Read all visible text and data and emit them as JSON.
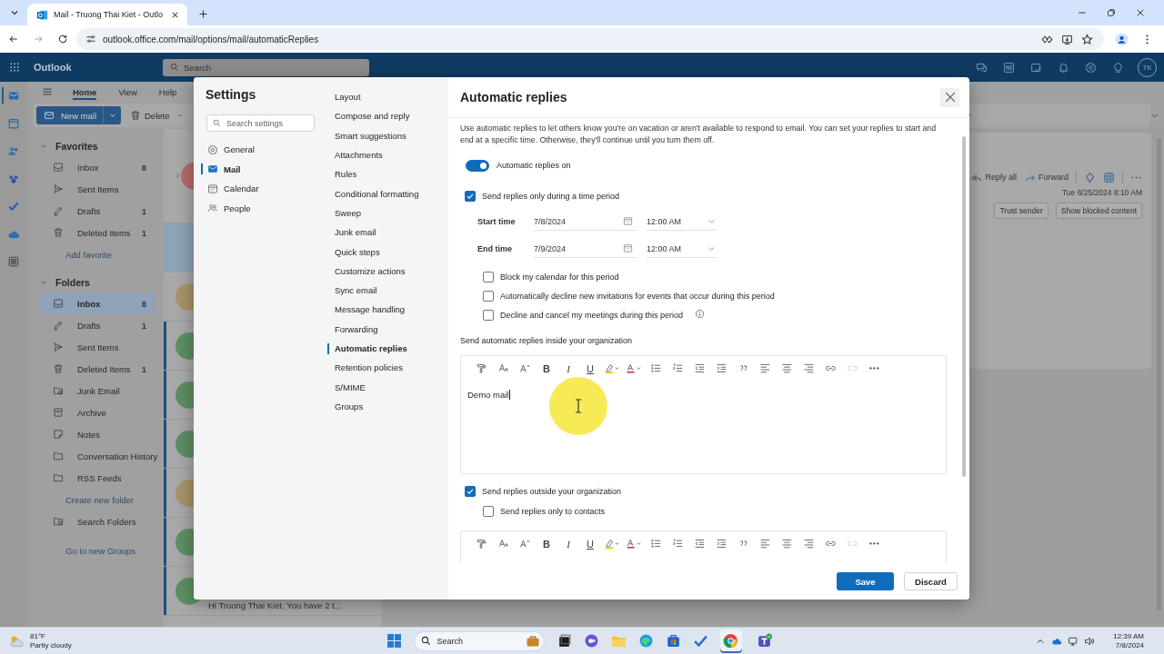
{
  "browser": {
    "tab_title": "Mail - Truong Thai Kiet - Outlo",
    "url": "outlook.office.com/mail/options/mail/automaticReplies"
  },
  "app": {
    "name": "Outlook",
    "search_placeholder": "Search",
    "avatar": "TK"
  },
  "rail": [
    {
      "kind": "mail",
      "selected": true
    },
    {
      "kind": "calendar",
      "selected": false
    },
    {
      "kind": "people",
      "selected": false
    },
    {
      "kind": "groups",
      "selected": false
    },
    {
      "kind": "todo",
      "selected": false
    },
    {
      "kind": "cloud",
      "selected": false
    },
    {
      "kind": "apps",
      "selected": false
    }
  ],
  "ribbon": {
    "tabs": [
      {
        "label": "Home",
        "selected": true
      },
      {
        "label": "View",
        "selected": false
      },
      {
        "label": "Help",
        "selected": false
      }
    ],
    "new_mail": "New mail",
    "delete": "Delete"
  },
  "favorites": {
    "title": "Favorites",
    "expanded": true,
    "items": [
      {
        "kind": "inbox",
        "label": "Inbox",
        "count": "8",
        "selected": false
      },
      {
        "kind": "sent",
        "label": "Sent Items",
        "selected": false
      },
      {
        "kind": "drafts",
        "label": "Drafts",
        "count": "1",
        "selected": false
      },
      {
        "kind": "deleted",
        "label": "Deleted Items",
        "count": "1",
        "selected": false
      },
      {
        "kind": "link",
        "label": "Add favorite"
      }
    ]
  },
  "folders": {
    "title": "Folders",
    "expanded": true,
    "items": [
      {
        "kind": "inbox",
        "label": "Inbox",
        "count": "8",
        "selected": true
      },
      {
        "kind": "drafts",
        "label": "Drafts",
        "count": "1",
        "selected": false
      },
      {
        "kind": "sent",
        "label": "Sent Items",
        "selected": false
      },
      {
        "kind": "deleted",
        "label": "Deleted Items",
        "count": "1",
        "selected": false
      },
      {
        "kind": "junk",
        "label": "Junk Email",
        "selected": false
      },
      {
        "kind": "archive",
        "label": "Archive",
        "selected": false
      },
      {
        "kind": "notes",
        "label": "Notes",
        "selected": false
      },
      {
        "kind": "folder",
        "label": "Conversation History",
        "selected": false
      },
      {
        "kind": "folder",
        "label": "RSS Feeds",
        "selected": false
      },
      {
        "kind": "link",
        "label": "Create new folder"
      },
      {
        "kind": "searchfolder",
        "label": "Search Folders",
        "selected": false
      }
    ]
  },
  "groups_link": "Go to new Groups",
  "message_list": {
    "rows": [
      {
        "kind": "thread",
        "color": "#b56a6a",
        "selected": false,
        "unread": false
      },
      {
        "kind": "message",
        "selected": true,
        "unread": false
      },
      {
        "kind": "message",
        "color": "#a8946a",
        "selected": false,
        "unread": false
      },
      {
        "kind": "message",
        "color": "#5e8f64",
        "selected": false,
        "unread": true
      },
      {
        "kind": "message",
        "color": "#5e8f64",
        "selected": false,
        "unread": true
      },
      {
        "kind": "message",
        "color": "#5e8f64",
        "selected": false,
        "unread": true
      },
      {
        "kind": "message",
        "color": "#a8946a",
        "selected": false,
        "unread": true
      },
      {
        "kind": "message",
        "color": "#5e8f64",
        "selected": false,
        "unread": true
      },
      {
        "kind": "message",
        "color": "#5e8f64",
        "selected": false,
        "unread": true,
        "preview": "Hi Truong Thai Kiet. You have 2 t..."
      }
    ]
  },
  "reading_pane": {
    "actions": [
      "Reply all",
      "Forward"
    ],
    "date": "Tue 6/25/2024 8:10 AM",
    "buttons": [
      "Trust sender",
      "Show blocked content"
    ]
  },
  "settings": {
    "title": "Settings",
    "search_placeholder": "Search settings",
    "categories": [
      {
        "kind": "gear",
        "label": "General",
        "selected": false
      },
      {
        "kind": "mail",
        "label": "Mail",
        "selected": true
      },
      {
        "kind": "calendar",
        "label": "Calendar",
        "selected": false
      },
      {
        "kind": "people",
        "label": "People",
        "selected": false
      }
    ],
    "sections": [
      {
        "label": "Layout",
        "selected": false
      },
      {
        "label": "Compose and reply",
        "selected": false
      },
      {
        "label": "Smart suggestions",
        "selected": false
      },
      {
        "label": "Attachments",
        "selected": false
      },
      {
        "label": "Rules",
        "selected": false
      },
      {
        "label": "Conditional formatting",
        "selected": false
      },
      {
        "label": "Sweep",
        "selected": false
      },
      {
        "label": "Junk email",
        "selected": false
      },
      {
        "label": "Quick steps",
        "selected": false
      },
      {
        "label": "Customize actions",
        "selected": false
      },
      {
        "label": "Sync email",
        "selected": false
      },
      {
        "label": "Message handling",
        "selected": false
      },
      {
        "label": "Forwarding",
        "selected": false
      },
      {
        "label": "Automatic replies",
        "selected": true
      },
      {
        "label": "Retention policies",
        "selected": false
      },
      {
        "label": "S/MIME",
        "selected": false
      },
      {
        "label": "Groups",
        "selected": false
      }
    ],
    "page": {
      "title": "Automatic replies",
      "description": "Use automatic replies to let others know you're on vacation or aren't available to respond to email. You can set your replies to start and end at a specific time. Otherwise, they'll continue until you turn them off.",
      "toggle": {
        "label": "Automatic replies on",
        "on": true
      },
      "time_period": {
        "label": "Send replies only during a time period",
        "checked": true
      },
      "start": {
        "label": "Start time",
        "date": "7/8/2024",
        "time": "12:00 AM"
      },
      "end": {
        "label": "End time",
        "date": "7/9/2024",
        "time": "12:00 AM"
      },
      "options": [
        {
          "label": "Block my calendar for this period",
          "checked": false,
          "info": false
        },
        {
          "label": "Automatically decline new invitations for events that occur during this period",
          "checked": false,
          "info": false
        },
        {
          "label": "Decline and cancel my meetings during this period",
          "checked": false,
          "info": true
        }
      ],
      "inside_label": "Send automatic replies inside your organization",
      "inside_body": "Demo mail",
      "toolbar_glyphs": [
        "B",
        "I",
        "U"
      ],
      "toolbar2_glyphs": [
        "B",
        "I",
        "U"
      ],
      "outside": {
        "label": "Send replies outside your organization",
        "checked": true
      },
      "contacts_only": {
        "label": "Send replies only to contacts",
        "checked": false
      },
      "save": "Save",
      "discard": "Discard"
    }
  },
  "taskbar": {
    "temperature": "81°F",
    "weather": "Partly cloudy",
    "search_placeholder": "Search",
    "time": "12:39 AM",
    "date": "7/8/2024"
  }
}
